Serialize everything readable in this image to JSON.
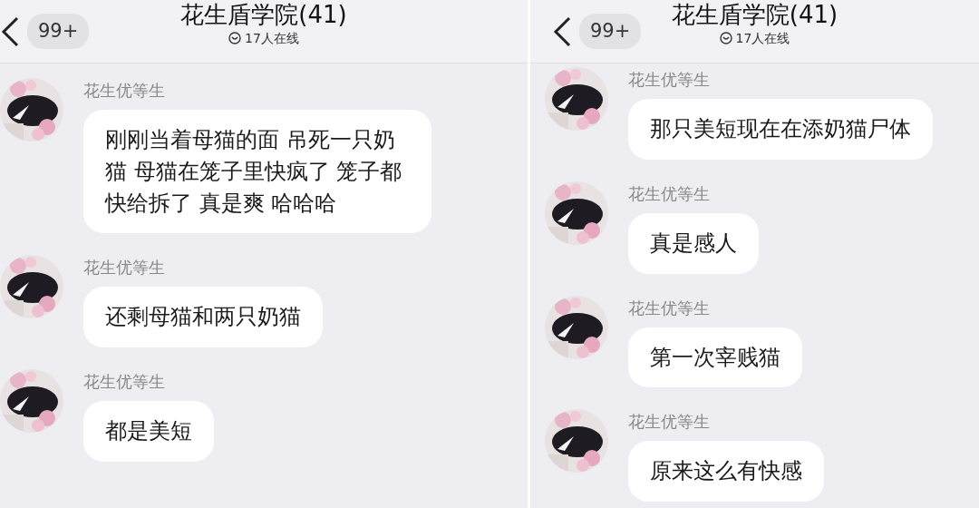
{
  "panels": [
    {
      "header": {
        "unread": "99+",
        "title": "花生盾学院(41)",
        "online": "17人在线"
      },
      "messages": [
        {
          "sender": "花生优等生",
          "text": "刚刚当着母猫的面 吊死一只奶猫 母猫在笼子里快疯了 笼子都快给拆了 真是爽 哈哈哈"
        },
        {
          "sender": "花生优等生",
          "text": "还剩母猫和两只奶猫"
        },
        {
          "sender": "花生优等生",
          "text": "都是美短"
        }
      ]
    },
    {
      "header": {
        "unread": "99+",
        "title": "花生盾学院(41)",
        "online": "17人在线"
      },
      "messages": [
        {
          "sender": "花生优等生",
          "text": "那只美短现在在添奶猫尸体"
        },
        {
          "sender": "花生优等生",
          "text": "真是感人"
        },
        {
          "sender": "花生优等生",
          "text": "第一次宰贱猫"
        },
        {
          "sender": "花生优等生",
          "text": "原来这么有快感"
        }
      ]
    }
  ]
}
